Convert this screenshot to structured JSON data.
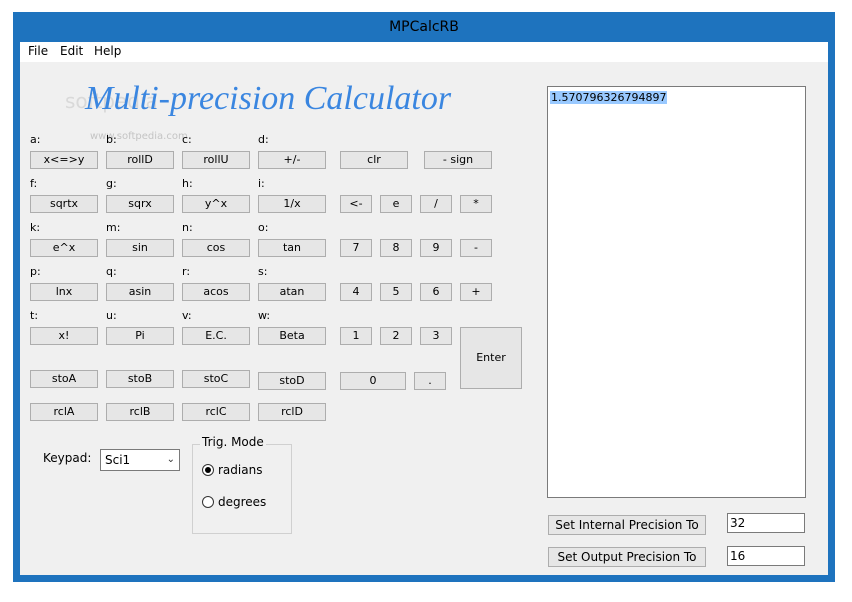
{
  "window": {
    "title": "MPCalcRB"
  },
  "menu": {
    "file": "File",
    "edit": "Edit",
    "help": "Help"
  },
  "heading": "Multi-precision Calculator",
  "watermark": {
    "large": "softpedia",
    "small": "www.softpedia.com"
  },
  "labels": {
    "a": "a:",
    "b": "b:",
    "c": "c:",
    "d": "d:",
    "f": "f:",
    "g": "g:",
    "h": "h:",
    "i": "i:",
    "k": "k:",
    "m": "m:",
    "n": "n:",
    "o": "o:",
    "p": "p:",
    "q": "q:",
    "r": "r:",
    "s": "s:",
    "t": "t:",
    "u": "u:",
    "v": "v:",
    "w": "w:"
  },
  "buttons": {
    "swap": "x<=>y",
    "rollD": "rollD",
    "rollU": "rollU",
    "plusminus": "+/-",
    "sqrtx": "sqrtx",
    "sqrx": "sqrx",
    "ypowx": "y^x",
    "recip": "1/x",
    "epowx": "e^x",
    "sin": "sin",
    "cos": "cos",
    "tan": "tan",
    "lnx": "lnx",
    "asin": "asin",
    "acos": "acos",
    "atan": "atan",
    "fact": "x!",
    "pi": "Pi",
    "ec": "E.C.",
    "beta": "Beta",
    "stoA": "stoA",
    "stoB": "stoB",
    "stoC": "stoC",
    "stoD": "stoD",
    "rclA": "rclA",
    "rclB": "rclB",
    "rclC": "rclC",
    "rclD": "rclD",
    "clr": "clr",
    "sign": "- sign",
    "back": "<-",
    "e": "e",
    "div": "/",
    "mul": "*",
    "seven": "7",
    "eight": "8",
    "nine": "9",
    "minus": "-",
    "four": "4",
    "five": "5",
    "six": "6",
    "plus": "+",
    "one": "1",
    "two": "2",
    "three": "3",
    "enter": "Enter",
    "zero": "0",
    "dot": "."
  },
  "keypad": {
    "label": "Keypad:",
    "value": "Sci1"
  },
  "trig": {
    "title": "Trig. Mode",
    "radians": "radians",
    "degrees": "degrees"
  },
  "output": {
    "value": "1.570796326794897"
  },
  "precision": {
    "internal_label": "Set Internal Precision To",
    "internal_value": "32",
    "output_label": "Set Output Precision To",
    "output_value": "16"
  }
}
